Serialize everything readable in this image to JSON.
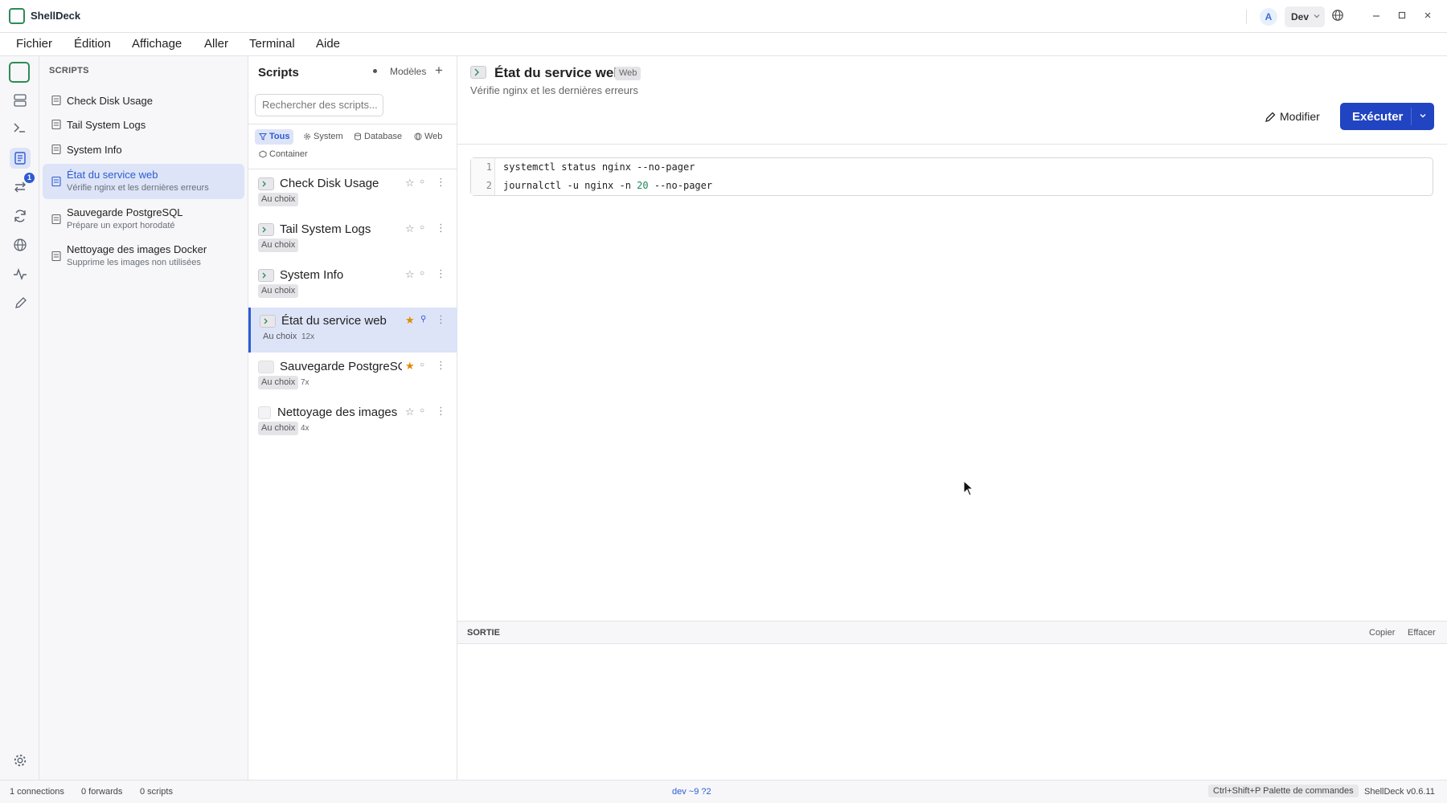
{
  "app": {
    "title": "ShellDeck",
    "avatar": "A",
    "environment": "Dev"
  },
  "menu": [
    "Fichier",
    "Édition",
    "Affichage",
    "Aller",
    "Terminal",
    "Aide"
  ],
  "activity": {
    "badge_count": "1"
  },
  "sidebar": {
    "title": "SCRIPTS",
    "items": [
      {
        "label": "Check Disk Usage",
        "sub": ""
      },
      {
        "label": "Tail System Logs",
        "sub": ""
      },
      {
        "label": "System Info",
        "sub": ""
      },
      {
        "label": "État du service web",
        "sub": "Vérifie nginx et les dernières erreurs"
      },
      {
        "label": "Sauvegarde PostgreSQL",
        "sub": "Prépare un export horodaté"
      },
      {
        "label": "Nettoyage des images Docker",
        "sub": "Supprime les images non utilisées"
      }
    ]
  },
  "list": {
    "title": "Scripts",
    "models_label": "Modèles",
    "add_label": "+",
    "search_placeholder": "Rechercher des scripts...",
    "filters": [
      "Tous",
      "System",
      "Database",
      "Web",
      "Container"
    ],
    "rows": [
      {
        "name": "Check Disk Usage",
        "tag": "Au choix",
        "count": ""
      },
      {
        "name": "Tail System Logs",
        "tag": "Au choix",
        "count": ""
      },
      {
        "name": "System Info",
        "tag": "Au choix",
        "count": ""
      },
      {
        "name": "État du service web",
        "tag": "Au choix",
        "count": "12x"
      },
      {
        "name": "Sauvegarde PostgreSQL",
        "tag": "Au choix",
        "count": "7x"
      },
      {
        "name": "Nettoyage des images Docker",
        "tag": "Au choix",
        "count": "4x"
      }
    ]
  },
  "main": {
    "title": "État du service web",
    "badge": "Web",
    "description": "Vérifie nginx et les dernières erreurs",
    "edit_label": "Modifier",
    "run_label": "Exécuter",
    "code": {
      "line1_num": "1",
      "line1": "systemctl status nginx --no-pager",
      "line2_num": "2",
      "line2_pre": "journalctl -u nginx -n ",
      "line2_num_val": "20",
      "line2_post": " --no-pager"
    },
    "output": {
      "title": "SORTIE",
      "copy_label": "Copier",
      "clear_label": "Effacer"
    }
  },
  "status": {
    "connections": "1 connections",
    "forwards": "0 forwards",
    "scripts": "0 scripts",
    "branch": "dev ~9 ?2",
    "palette": "Ctrl+Shift+P Palette de commandes",
    "version": "ShellDeck v0.6.11"
  },
  "colors": {
    "accent": "#2d5bd3",
    "run_button": "#2144c2",
    "star_active": "#e08a00",
    "selection": "#dde4f7",
    "logo": "#2e8b57"
  }
}
